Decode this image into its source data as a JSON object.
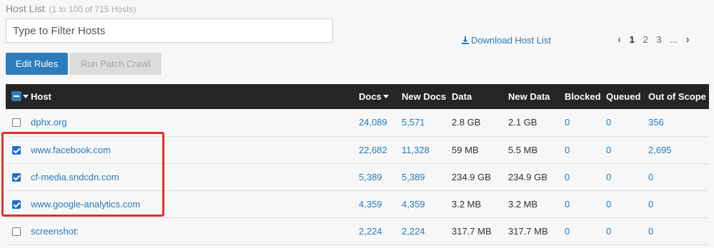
{
  "header": {
    "title": "Host List",
    "subtitle": "(1 to 100 of 715 Hosts)"
  },
  "filter": {
    "placeholder": "Type to Filter Hosts"
  },
  "download_label": "Download Host List",
  "pager": {
    "current": "1",
    "pages": [
      "2",
      "3"
    ],
    "ellipsis": "...",
    "prev": "‹",
    "next": "›"
  },
  "buttons": {
    "edit_rules": "Edit Rules",
    "run_patch_crawl": "Run Patch Crawl"
  },
  "table": {
    "columns": [
      "Host",
      "Docs",
      "New Docs",
      "Data",
      "New Data",
      "Blocked",
      "Queued",
      "Out of Scope"
    ],
    "rows": [
      {
        "checked": false,
        "host": "dphx.org",
        "docs": "24,089",
        "new_docs": "5,571",
        "data": "2.8 GB",
        "new_data": "2.1 GB",
        "blocked": "0",
        "queued": "0",
        "out_of_scope": "356"
      },
      {
        "checked": true,
        "host": "www.facebook.com",
        "docs": "22,682",
        "new_docs": "11,328",
        "data": "59 MB",
        "new_data": "5.5 MB",
        "blocked": "0",
        "queued": "0",
        "out_of_scope": "2,695"
      },
      {
        "checked": true,
        "host": "cf-media.sndcdn.com",
        "docs": "5,389",
        "new_docs": "5,389",
        "data": "234.9 GB",
        "new_data": "234.9 GB",
        "blocked": "0",
        "queued": "0",
        "out_of_scope": "0"
      },
      {
        "checked": true,
        "host": "www.google-analytics.com",
        "docs": "4,359",
        "new_docs": "4,359",
        "data": "3.2 MB",
        "new_data": "3.2 MB",
        "blocked": "0",
        "queued": "0",
        "out_of_scope": "0"
      },
      {
        "checked": false,
        "host": "screenshot:",
        "docs": "2,224",
        "new_docs": "2,224",
        "data": "317.7 MB",
        "new_data": "317.7 MB",
        "blocked": "0",
        "queued": "0",
        "out_of_scope": "0"
      }
    ]
  },
  "colors": {
    "accent": "#2d7dbd",
    "link": "#2a7ab8",
    "header_bg": "#252525",
    "highlight": "#e0322d"
  }
}
